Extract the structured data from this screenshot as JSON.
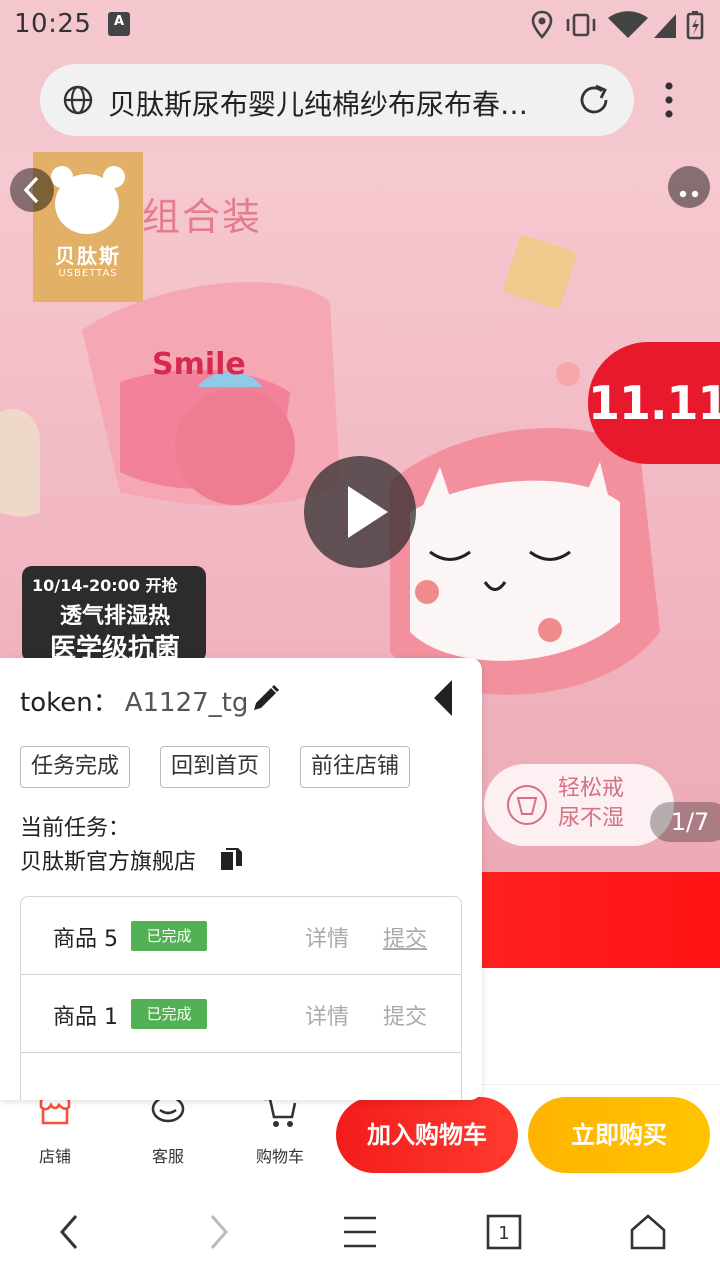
{
  "status_bar": {
    "time": "10:25",
    "notification_badge": "A"
  },
  "browser": {
    "page_title": "贝肽斯尿布婴儿纯棉纱布尿布春…"
  },
  "hero": {
    "brand_name": "贝肽斯",
    "brand_sub": "USBETTAS",
    "heading": "组合装",
    "promo_badge": "11.11",
    "sale_date": "10/14-20:00 开抢",
    "sale_line1": "透气排湿热",
    "sale_line2": "医学级抗菌",
    "feature_line1": "轻松戒",
    "feature_line2": "尿不湿",
    "image_counter": "1/7"
  },
  "panel": {
    "token_label": "token：",
    "token_value": "A1127_tg",
    "buttons": {
      "task_done": "任务完成",
      "back_home": "回到首页",
      "go_shop": "前往店铺"
    },
    "current_task_label": "当前任务：",
    "shop_name": "贝肽斯官方旗舰店",
    "items": [
      {
        "name": "商品 5",
        "status": "已完成",
        "detail": "详情",
        "submit": "提交"
      },
      {
        "name": "商品 1",
        "status": "已完成",
        "detail": "详情",
        "submit": "提交"
      }
    ]
  },
  "action_bar": {
    "shop": "店铺",
    "service": "客服",
    "cart": "购物车",
    "add_to_cart": "加入购物车",
    "buy_now": "立即购买"
  },
  "colors": {
    "accent_red": "#f31c1c",
    "accent_yellow": "#ffb400",
    "status_green": "#52b154",
    "header_pink": "#f4c6ce"
  }
}
